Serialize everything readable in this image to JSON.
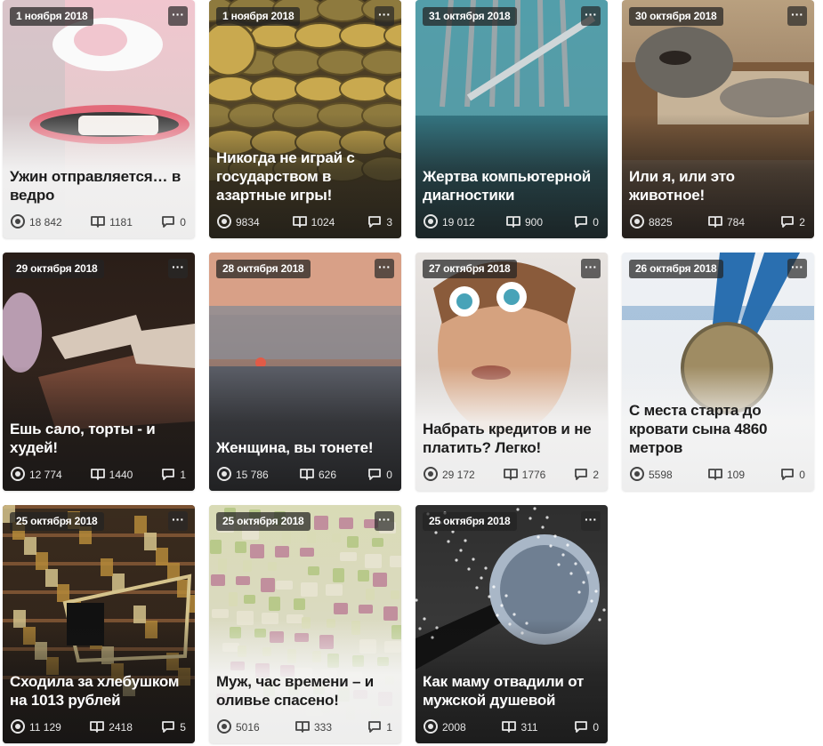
{
  "menu_glyph": "···",
  "cards": [
    {
      "date": "1 ноября 2018",
      "title": "Ужин отправляется… в ведро",
      "views": "18 842",
      "reads": "1181",
      "comments": "0",
      "theme": "light",
      "colors": [
        "#f1c6cf",
        "#e7e2df",
        "#c2c2c4",
        "#e36a7a",
        "#d7cfca"
      ]
    },
    {
      "date": "1 ноября 2018",
      "title": "Никогда не играй с государством в азартные игры!",
      "views": "9834",
      "reads": "1024",
      "comments": "3",
      "theme": "dark",
      "colors": [
        "#3d3220",
        "#8e7a3e",
        "#c9a94f",
        "#5e4e26",
        "#6d5a31"
      ]
    },
    {
      "date": "31 октября 2018",
      "title": "Жертва компьютерной диагностики",
      "views": "19 012",
      "reads": "900",
      "comments": "0",
      "theme": "dark",
      "colors": [
        "#2e7b8a",
        "#6cb5bf",
        "#9aa6aa",
        "#1f5663",
        "#3b6f78"
      ]
    },
    {
      "date": "30 октября 2018",
      "title": "Или я, или это животное!",
      "views": "8825",
      "reads": "784",
      "comments": "2",
      "theme": "dark",
      "colors": [
        "#b9a07f",
        "#7b5a3c",
        "#e7d9bf",
        "#4c3626",
        "#6d5340"
      ]
    },
    {
      "date": "29 октября 2018",
      "title": "Ешь сало, торты - и худей!",
      "views": "12 774",
      "reads": "1440",
      "comments": "1",
      "theme": "dark",
      "colors": [
        "#2a1e18",
        "#d7c8b9",
        "#7a4b39",
        "#b89cb0",
        "#3a2a22"
      ]
    },
    {
      "date": "28 октября 2018",
      "title": "Женщина, вы тонете!",
      "views": "15 786",
      "reads": "626",
      "comments": "0",
      "theme": "dark",
      "colors": [
        "#d8a087",
        "#8b8c93",
        "#5b5e67",
        "#3a3b40",
        "#4a4b51"
      ]
    },
    {
      "date": "27 октября 2018",
      "title": "Набрать кредитов и не платить? Легко!",
      "views": "29 172",
      "reads": "1776",
      "comments": "2",
      "theme": "light",
      "colors": [
        "#e8e4e1",
        "#d5a27f",
        "#8a5b3b",
        "#48a3b8",
        "#cfc9c5"
      ]
    },
    {
      "date": "26 октября 2018",
      "title": "С места старта до кровати сына 4860 метров",
      "views": "5598",
      "reads": "109",
      "comments": "0",
      "theme": "light",
      "colors": [
        "#eef1f5",
        "#2a6fb0",
        "#9f8c63",
        "#6e6246",
        "#e9ecef"
      ]
    },
    {
      "date": "25 октября 2018",
      "title": "Сходила за хлебушком на 1013 рублей",
      "views": "11 129",
      "reads": "2418",
      "comments": "5",
      "theme": "dark",
      "colors": [
        "#3b2c1e",
        "#b58a3a",
        "#7a5232",
        "#d5c38c",
        "#2b2018"
      ]
    },
    {
      "date": "25 октября 2018",
      "title": "Муж, час времени – и оливье спасено!",
      "views": "5016",
      "reads": "333",
      "comments": "1",
      "theme": "light",
      "colors": [
        "#d9dbb6",
        "#b8c98a",
        "#c18f9d",
        "#e6e3cf",
        "#dcd9cb"
      ]
    },
    {
      "date": "25 октября 2018",
      "title": "Как маму отвадили от мужской душевой",
      "views": "2008",
      "reads": "311",
      "comments": "0",
      "theme": "dark",
      "colors": [
        "#3a3a3a",
        "#a9b7c7",
        "#6f7f92",
        "#1d1d1d",
        "#5b5b5b"
      ]
    }
  ]
}
